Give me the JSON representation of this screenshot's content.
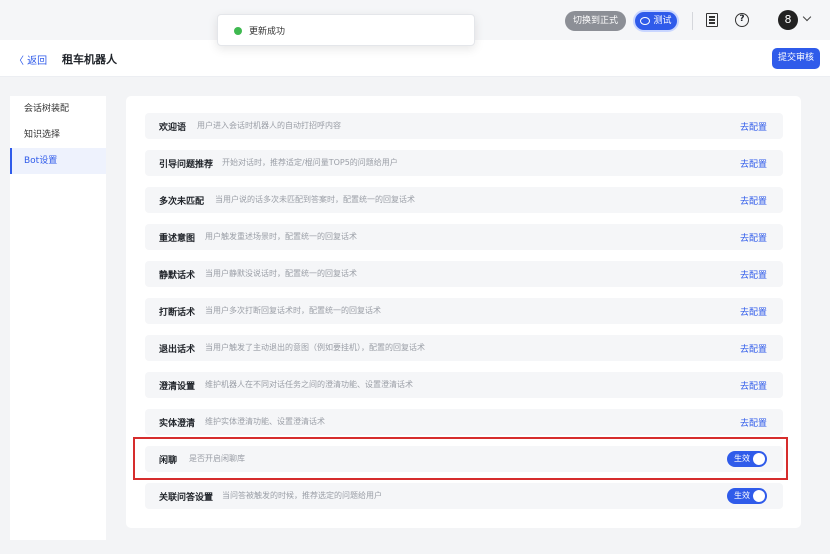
{
  "header": {
    "switch_label": "切换到正式",
    "test_label": "测试",
    "avatar_text": "8"
  },
  "toast": {
    "message": "更新成功"
  },
  "subheader": {
    "back_label": "〈 返回",
    "title": "租车机器人",
    "submit_label": "提交审核"
  },
  "sidebar": {
    "items": [
      {
        "label": "会话树装配"
      },
      {
        "label": "知识选择"
      },
      {
        "label": "Bot设置"
      }
    ]
  },
  "settings": {
    "config_label": "去配置",
    "toggle_label": "生效",
    "rows": [
      {
        "label": "欢迎语",
        "desc": "用户进入会话时机器人的自动打招呼内容"
      },
      {
        "label": "引导问题推荐",
        "desc": "开始对话时，推荐适定/棍问量TOP5的问题给用户"
      },
      {
        "label": "多次未匹配",
        "desc": "当用户说的话多次未匹配到答案时，配置统一的回复话术"
      },
      {
        "label": "重述意图",
        "desc": "用户触发重述场景时，配置统一的回复话术"
      },
      {
        "label": "静默话术",
        "desc": "当用户静默没说话时，配置统一的回复话术"
      },
      {
        "label": "打断话术",
        "desc": "当用户多次打断回复话术时，配置统一的回复话术"
      },
      {
        "label": "退出话术",
        "desc": "当用户触发了主动退出的意图（例如要挂机），配置的回复话术"
      },
      {
        "label": "澄清设置",
        "desc": "维护机器人在不同对话任务之间的澄清功能、设置澄清话术"
      },
      {
        "label": "实体澄清",
        "desc": "维护实体澄清功能、设置澄清话术"
      },
      {
        "label": "闲聊",
        "desc": "是否开启闲聊库"
      },
      {
        "label": "关联问答设置",
        "desc": "当问答被触发的时候，推荐选定的问题给用户"
      }
    ]
  }
}
